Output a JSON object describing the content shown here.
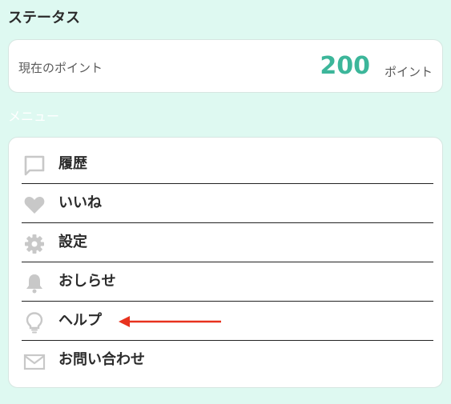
{
  "status": {
    "title": "ステータス"
  },
  "points": {
    "label": "現在のポイント",
    "value": "200",
    "unit": "ポイント"
  },
  "menu": {
    "title": "メニュー",
    "items": [
      {
        "label": "履歴",
        "icon": "chat-bubble-icon"
      },
      {
        "label": "いいね",
        "icon": "heart-icon"
      },
      {
        "label": "設定",
        "icon": "gear-icon"
      },
      {
        "label": "おしらせ",
        "icon": "bell-icon"
      },
      {
        "label": "ヘルプ",
        "icon": "lightbulb-icon"
      },
      {
        "label": "お問い合わせ",
        "icon": "mail-icon"
      }
    ]
  },
  "colors": {
    "background": "#def9f1",
    "accent": "#3cb69a",
    "icon": "#c8c8c8",
    "arrow": "#e8321e"
  }
}
